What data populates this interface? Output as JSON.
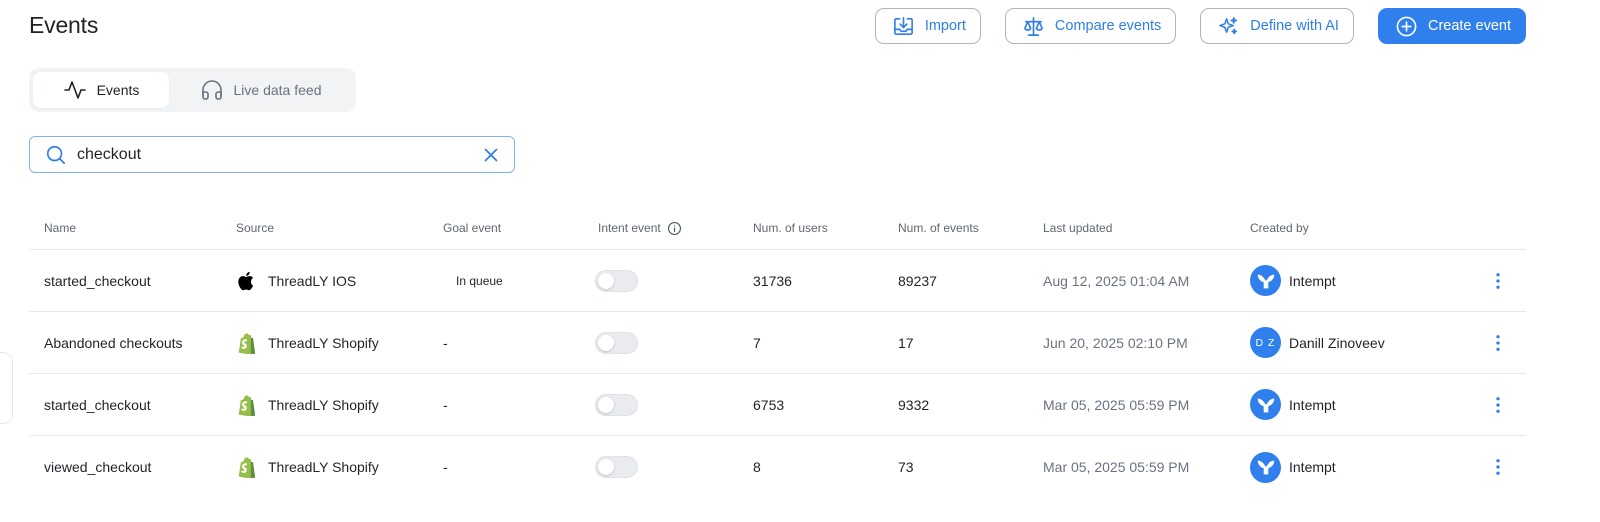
{
  "header": {
    "title": "Events"
  },
  "actions": {
    "import": "Import",
    "compare": "Compare events",
    "define_ai": "Define with AI",
    "create": "Create event"
  },
  "tabs": {
    "events": "Events",
    "live": "Live data feed"
  },
  "search": {
    "value": "checkout"
  },
  "columns": {
    "name": "Name",
    "source": "Source",
    "goal": "Goal event",
    "intent": "Intent event",
    "users": "Num. of users",
    "events": "Num. of events",
    "updated": "Last updated",
    "created": "Created by"
  },
  "rows": [
    {
      "name": "started_checkout",
      "source": "ThreadLY IOS",
      "source_icon": "apple-icon",
      "goal": "In queue",
      "intent_on": false,
      "users": "31736",
      "events": "89237",
      "updated": "Aug 12, 2025 01:04 AM",
      "created": "Intempt",
      "avatar": "whale-icon"
    },
    {
      "name": "Abandoned checkouts",
      "source": "ThreadLY Shopify",
      "source_icon": "shopify-icon",
      "goal": "-",
      "intent_on": false,
      "users": "7",
      "events": "17",
      "updated": "Jun 20, 2025 02:10 PM",
      "created": "Danill Zinoveev",
      "avatar_initials": "D Z"
    },
    {
      "name": "started_checkout",
      "source": "ThreadLY Shopify",
      "source_icon": "shopify-icon",
      "goal": "-",
      "intent_on": false,
      "users": "6753",
      "events": "9332",
      "updated": "Mar 05, 2025 05:59 PM",
      "created": "Intempt",
      "avatar": "whale-icon"
    },
    {
      "name": "viewed_checkout",
      "source": "ThreadLY Shopify",
      "source_icon": "shopify-icon",
      "goal": "-",
      "intent_on": false,
      "users": "8",
      "events": "73",
      "updated": "Mar 05, 2025 05:59 PM",
      "created": "Intempt",
      "avatar": "whale-icon"
    }
  ],
  "colors": {
    "accent": "#2f80ed",
    "shopify": "#95bf47"
  }
}
